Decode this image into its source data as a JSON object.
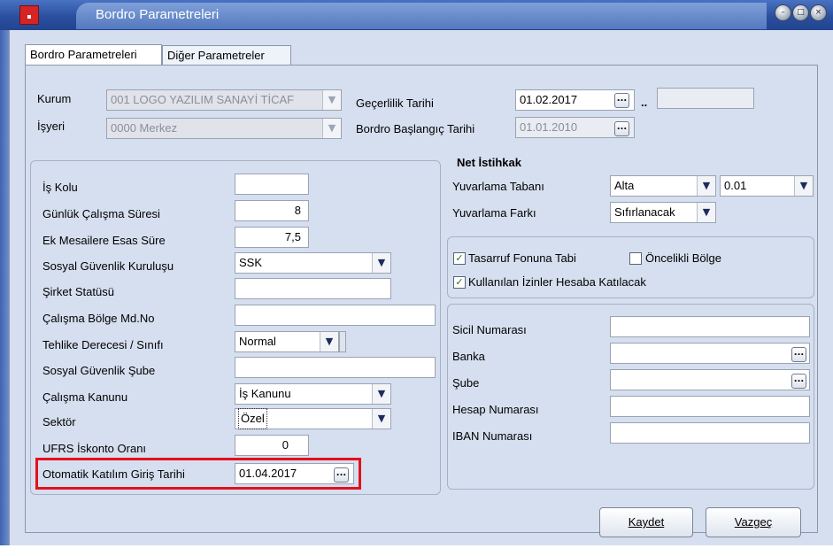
{
  "window": {
    "title": "Bordro Parametreleri",
    "buttons": [
      "minimize",
      "maximize",
      "close"
    ]
  },
  "tabs": [
    {
      "label": "Bordro Parametreleri",
      "active": true
    },
    {
      "label": "Diğer Parametreler",
      "active": false
    }
  ],
  "top": {
    "kurum_label": "Kurum",
    "kurum_value": "001 LOGO YAZILIM SANAYİ TİCAF",
    "isyeri_label": "İşyeri",
    "isyeri_value": "0000 Merkez",
    "gecerlilik_label": "Geçerlilik Tarihi",
    "gecerlilik_value": "01.02.2017",
    "gecerlilik_sep": "..",
    "gecerlilik_end": "",
    "baslangic_label": "Bordro Başlangıç Tarihi",
    "baslangic_value": "01.01.2010"
  },
  "left_fields": [
    {
      "label": "İş Kolu",
      "value": ""
    },
    {
      "label": "Günlük Çalışma Süresi",
      "value": "8"
    },
    {
      "label": "Ek Mesailere Esas Süre",
      "value": "7,5"
    },
    {
      "label": "Sosyal Güvenlik Kuruluşu",
      "value": "SSK"
    },
    {
      "label": "Şirket Statüsü",
      "value": ""
    },
    {
      "label": "Çalışma Bölge Md.No",
      "value": ""
    },
    {
      "label": "Tehlike Derecesi / Sınıfı",
      "value": "Normal"
    },
    {
      "label": "Sosyal Güvenlik Şube",
      "value": ""
    },
    {
      "label": "Çalışma Kanunu",
      "value": "İş Kanunu"
    },
    {
      "label": "Sektör",
      "value": "Özel"
    },
    {
      "label": "UFRS İskonto Oranı",
      "value": "0"
    },
    {
      "label": "Otomatik Katılım Giriş Tarihi",
      "value": "01.04.2017"
    }
  ],
  "net": {
    "title": "Net İstihkak",
    "taban_label": "Yuvarlama Tabanı",
    "taban_value": "Alta",
    "taban_step": "0.01",
    "fark_label": "Yuvarlama Farkı",
    "fark_value": "Sıfırlanacak"
  },
  "checks": [
    {
      "label": "Tasarruf Fonuna Tabi",
      "checked": true
    },
    {
      "label": "Öncelikli Bölge",
      "checked": false
    },
    {
      "label": "Kullanılan İzinler Hesaba Katılacak",
      "checked": true
    }
  ],
  "bank": [
    {
      "label": "Sicil Numarası",
      "value": ""
    },
    {
      "label": "Banka",
      "value": ""
    },
    {
      "label": "Şube",
      "value": ""
    },
    {
      "label": "Hesap Numarası",
      "value": ""
    },
    {
      "label": "IBAN Numarası",
      "value": ""
    }
  ],
  "buttons": {
    "save": "Kaydet",
    "cancel": "Vazgeç"
  },
  "icons": {
    "dropdown": "chevron-down-icon",
    "lookup": "ellipsis-icon",
    "check": "check-icon"
  },
  "colors": {
    "highlight": "#e3101c",
    "title_bar": "#2a4f9f"
  }
}
